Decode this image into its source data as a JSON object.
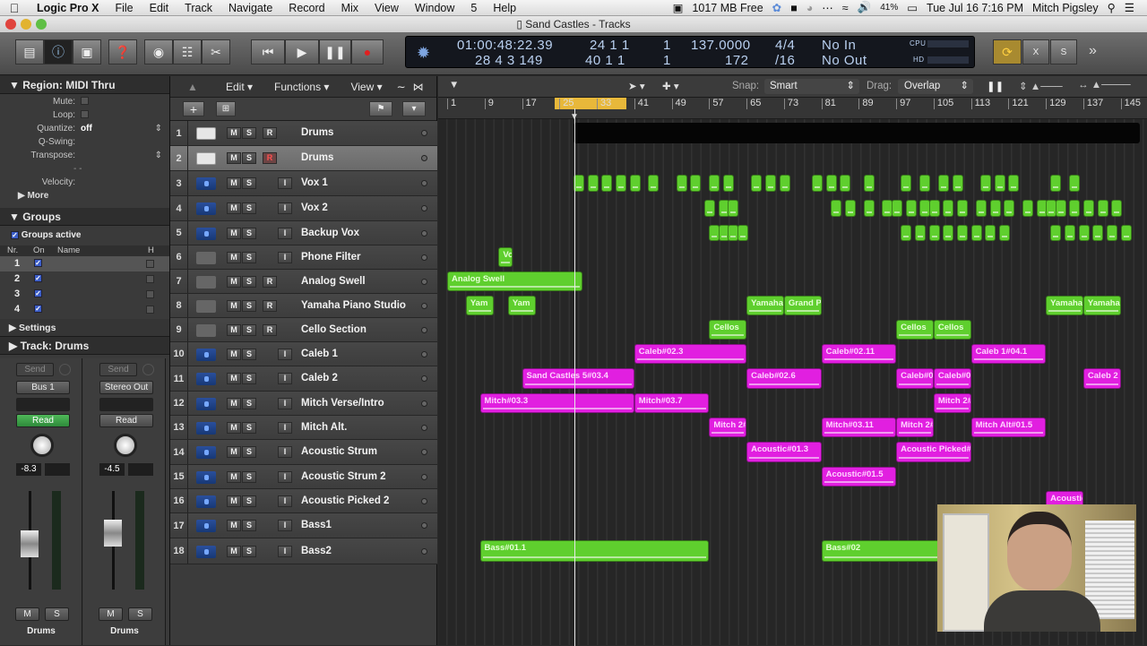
{
  "menubar": {
    "app": "Logic Pro X",
    "items": [
      "File",
      "Edit",
      "Track",
      "Navigate",
      "Record",
      "Mix",
      "View",
      "Window",
      "5",
      "Help"
    ],
    "memory": "1017 MB Free",
    "battery": "41%",
    "datetime": "Tue Jul 16  7:16 PM",
    "user": "Mitch Pigsley"
  },
  "window": {
    "title": "Sand Castles - Tracks"
  },
  "lcd": {
    "smpte": "01:00:48:22.39",
    "smpte_sub": "28  4  3  149",
    "bar": "24  1  1",
    "bar_tick": "1",
    "bar2": "40  1  1",
    "bar2_tick": "1",
    "tempo": "137.0000",
    "tempo_sub": "172",
    "sig": "4/4",
    "sig_sub": "/16",
    "in": "No In",
    "out": "No Out",
    "cpu": "CPU",
    "hd": "HD"
  },
  "inspector": {
    "region_header": "Region: MIDI Thru",
    "mute_label": "Mute:",
    "loop_label": "Loop:",
    "quantize_label": "Quantize:",
    "quantize_value": "off",
    "qswing_label": "Q-Swing:",
    "transpose_label": "Transpose:",
    "velocity_label": "Velocity:",
    "more_label": "More",
    "groups_header": "Groups",
    "groups_active": "Groups active",
    "groups_cols": [
      "Nr.",
      "On",
      "Name",
      "H"
    ],
    "groups": [
      "1",
      "2",
      "3",
      "4"
    ],
    "settings_label": "Settings",
    "track_header": "Track:  Drums"
  },
  "strips": [
    {
      "send": "Send",
      "output": "Bus 1",
      "automation": "Read",
      "value": "-8.3",
      "mute": "M",
      "solo": "S",
      "name": "Drums",
      "auto_active": true
    },
    {
      "send": "Send",
      "output": "Stereo Out",
      "automation": "Read",
      "value": "-4.5",
      "mute": "M",
      "solo": "S",
      "name": "Drums",
      "auto_active": false
    }
  ],
  "tracklist_menu": {
    "edit": "Edit",
    "functions": "Functions",
    "view": "View"
  },
  "arrange_toolbar": {
    "snap_label": "Snap:",
    "snap_value": "Smart",
    "drag_label": "Drag:",
    "drag_value": "Overlap"
  },
  "ruler": [
    "1",
    "9",
    "17",
    "25",
    "33",
    "41",
    "49",
    "57",
    "65",
    "73",
    "81",
    "89",
    "97",
    "105",
    "113",
    "121",
    "129",
    "137",
    "145"
  ],
  "tracks": [
    {
      "num": "1",
      "name": "Drums",
      "type": "drum",
      "btn": "R"
    },
    {
      "num": "2",
      "name": "Drums",
      "type": "drum",
      "btn": "R",
      "selected": true
    },
    {
      "num": "3",
      "name": "Vox 1",
      "type": "audio",
      "btn": "I"
    },
    {
      "num": "4",
      "name": "Vox 2",
      "type": "audio",
      "btn": "I"
    },
    {
      "num": "5",
      "name": "Backup Vox",
      "type": "audio",
      "btn": "I"
    },
    {
      "num": "6",
      "name": "Phone Filter",
      "type": "inst",
      "btn": "I"
    },
    {
      "num": "7",
      "name": "Analog Swell",
      "type": "inst",
      "btn": "R"
    },
    {
      "num": "8",
      "name": "Yamaha Piano Studio",
      "type": "inst",
      "btn": "R"
    },
    {
      "num": "9",
      "name": "Cello Section",
      "type": "inst",
      "btn": "R"
    },
    {
      "num": "10",
      "name": "Caleb 1",
      "type": "audio",
      "btn": "I"
    },
    {
      "num": "11",
      "name": "Caleb 2",
      "type": "audio",
      "btn": "I"
    },
    {
      "num": "12",
      "name": "Mitch Verse/Intro",
      "type": "audio",
      "btn": "I"
    },
    {
      "num": "13",
      "name": "Mitch Alt.",
      "type": "audio",
      "btn": "I"
    },
    {
      "num": "14",
      "name": "Acoustic Strum",
      "type": "audio",
      "btn": "I"
    },
    {
      "num": "15",
      "name": "Acoustic Strum 2",
      "type": "audio",
      "btn": "I"
    },
    {
      "num": "16",
      "name": "Acoustic Picked 2",
      "type": "audio",
      "btn": "I"
    },
    {
      "num": "17",
      "name": "Bass1",
      "type": "audio",
      "btn": "I"
    },
    {
      "num": "18",
      "name": "Bass2",
      "type": "audio",
      "btn": "I"
    }
  ],
  "regions": [
    {
      "track": 1,
      "label": "",
      "start": 28,
      "end": 149,
      "color": "k"
    },
    {
      "track": 7,
      "label": "Analog Swell",
      "start": 1,
      "end": 30,
      "color": "g"
    },
    {
      "track": 6,
      "label": "Vo",
      "start": 12,
      "end": 15,
      "color": "g"
    },
    {
      "track": 8,
      "label": "Yam",
      "start": 5,
      "end": 11,
      "color": "g"
    },
    {
      "track": 8,
      "label": "Yam",
      "start": 14,
      "end": 20,
      "color": "g"
    },
    {
      "track": 8,
      "label": "Yamaha",
      "start": 65,
      "end": 73,
      "color": "g"
    },
    {
      "track": 8,
      "label": "Grand P",
      "start": 73,
      "end": 81,
      "color": "g"
    },
    {
      "track": 8,
      "label": "Yamaha",
      "start": 129,
      "end": 137,
      "color": "g"
    },
    {
      "track": 8,
      "label": "Yamaha",
      "start": 137,
      "end": 145,
      "color": "g"
    },
    {
      "track": 9,
      "label": "Cellos",
      "start": 57,
      "end": 65,
      "color": "g"
    },
    {
      "track": 9,
      "label": "Cellos",
      "start": 97,
      "end": 105,
      "color": "g"
    },
    {
      "track": 9,
      "label": "Cellos",
      "start": 105,
      "end": 113,
      "color": "g"
    },
    {
      "track": 10,
      "label": "Caleb#02.3",
      "start": 41,
      "end": 65,
      "color": "m"
    },
    {
      "track": 10,
      "label": "Caleb#02.11",
      "start": 81,
      "end": 97,
      "color": "m"
    },
    {
      "track": 10,
      "label": "Caleb 1#04.1",
      "start": 113,
      "end": 129,
      "color": "m"
    },
    {
      "track": 11,
      "label": "Sand Castles  5#03.4",
      "start": 17,
      "end": 41,
      "color": "m"
    },
    {
      "track": 11,
      "label": "Caleb#02.6",
      "start": 65,
      "end": 81,
      "color": "m"
    },
    {
      "track": 11,
      "label": "Caleb#0",
      "start": 97,
      "end": 105,
      "color": "m"
    },
    {
      "track": 11,
      "label": "Caleb#0",
      "start": 105,
      "end": 113,
      "color": "m"
    },
    {
      "track": 11,
      "label": "Caleb 2",
      "start": 137,
      "end": 145,
      "color": "m"
    },
    {
      "track": 12,
      "label": "Mitch#03.3",
      "start": 8,
      "end": 41,
      "color": "m"
    },
    {
      "track": 12,
      "label": "Mitch#03.7",
      "start": 41,
      "end": 57,
      "color": "m"
    },
    {
      "track": 12,
      "label": "Mitch 2#",
      "start": 105,
      "end": 113,
      "color": "m"
    },
    {
      "track": 13,
      "label": "Mitch 2#",
      "start": 57,
      "end": 65,
      "color": "m"
    },
    {
      "track": 13,
      "label": "Mitch#03.11",
      "start": 81,
      "end": 97,
      "color": "m"
    },
    {
      "track": 13,
      "label": "Mitch 2#",
      "start": 97,
      "end": 105,
      "color": "m"
    },
    {
      "track": 13,
      "label": "Mitch Alt#01.5",
      "start": 113,
      "end": 129,
      "color": "m"
    },
    {
      "track": 14,
      "label": "Acoustic#01.3",
      "start": 65,
      "end": 81,
      "color": "m"
    },
    {
      "track": 14,
      "label": "Acoustic Picked#",
      "start": 97,
      "end": 113,
      "color": "m"
    },
    {
      "track": 15,
      "label": "Acoustic#01.5",
      "start": 81,
      "end": 97,
      "color": "m"
    },
    {
      "track": 16,
      "label": "Acoustic",
      "start": 129,
      "end": 137,
      "color": "m"
    },
    {
      "track": 18,
      "label": "Bass#01.1",
      "start": 8,
      "end": 57,
      "color": "g"
    },
    {
      "track": 18,
      "label": "Bass#02",
      "start": 81,
      "end": 110,
      "color": "g"
    }
  ],
  "colors": {
    "audio_region": "#e11fe0",
    "midi_region": "#5fcf2e",
    "cycle": "#e8b83a",
    "auto_read": "#3fa14a"
  }
}
